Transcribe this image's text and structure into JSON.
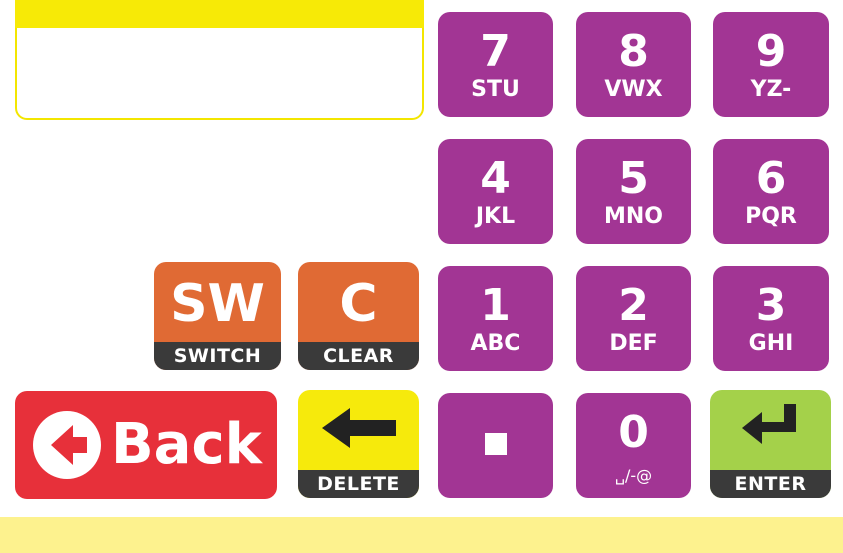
{
  "display": {
    "value": ""
  },
  "keys": {
    "k7": {
      "digit": "7",
      "letters": "STU"
    },
    "k8": {
      "digit": "8",
      "letters": "VWX"
    },
    "k9": {
      "digit": "9",
      "letters": "YZ-"
    },
    "k4": {
      "digit": "4",
      "letters": "JKL"
    },
    "k5": {
      "digit": "5",
      "letters": "MNO"
    },
    "k6": {
      "digit": "6",
      "letters": "PQR"
    },
    "k1": {
      "digit": "1",
      "letters": "ABC"
    },
    "k2": {
      "digit": "2",
      "letters": "DEF"
    },
    "k3": {
      "digit": "3",
      "letters": "GHI"
    },
    "k0": {
      "digit": "0",
      "letters": "␣/-@"
    }
  },
  "commands": {
    "switch": {
      "big": "SW",
      "label": "SWITCH"
    },
    "clear": {
      "big": "C",
      "label": "CLEAR"
    },
    "back": {
      "label": "Back"
    },
    "delete": {
      "label": "DELETE"
    },
    "enter": {
      "label": "ENTER"
    }
  },
  "icons": {
    "back": "arrow-left-circle-icon",
    "delete": "arrow-left-icon",
    "enter": "return-arrow-icon",
    "dot": "period-icon"
  },
  "colors": {
    "purple": "#a23594",
    "orange": "#e06a34",
    "red": "#e7303a",
    "yellow": "#f6ea0c",
    "green": "#a4d14a",
    "band": "#3a3a3a",
    "bottom_band": "#fdf28e"
  }
}
